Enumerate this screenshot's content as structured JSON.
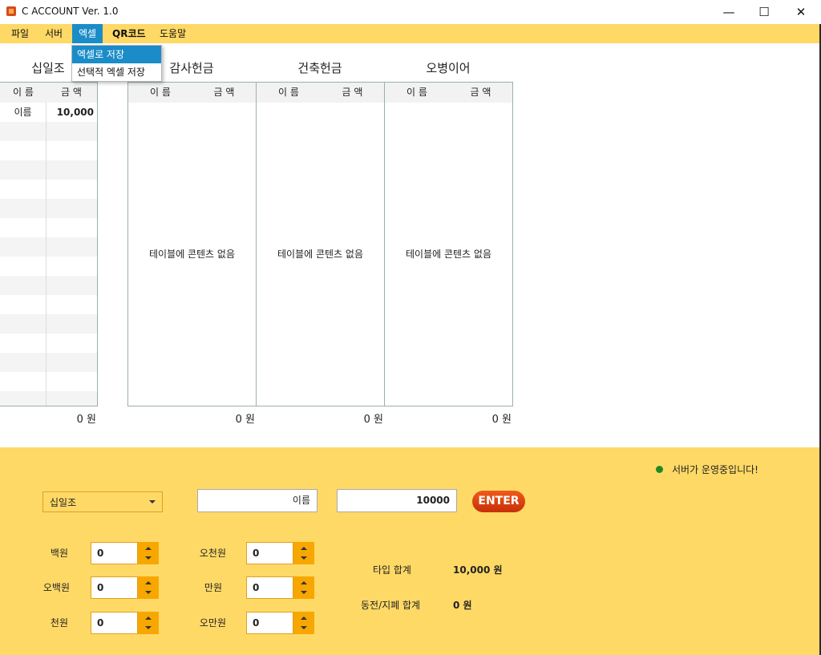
{
  "window": {
    "title": "C ACCOUNT Ver. 1.0",
    "min_glyph": "—",
    "max_glyph": "☐",
    "close_glyph": "✕"
  },
  "menu": {
    "items": [
      "파일",
      "서버",
      "엑셀",
      "QR코드",
      "도움말"
    ],
    "active": "엑셀",
    "dropdown": [
      "엑셀로 저장",
      "선택적 엑셀 저장"
    ],
    "dropdown_highlighted": "엑셀로 저장"
  },
  "columns": {
    "name": "이 름",
    "amount": "금 액"
  },
  "panels": [
    {
      "title": "십일조",
      "empty_message": "",
      "rows": [
        {
          "name": "이름",
          "amount": "10,000"
        }
      ],
      "total": "0 원"
    },
    {
      "title": "감사헌금",
      "empty_message": "테이블에 콘텐츠 없음",
      "rows": [],
      "total": "0 원"
    },
    {
      "title": "건축헌금",
      "empty_message": "테이블에 콘텐츠 없음",
      "rows": [],
      "total": "0 원"
    },
    {
      "title": "오병이어",
      "empty_message": "테이블에 콘텐츠 없음",
      "rows": [],
      "total": "0 원"
    }
  ],
  "status": {
    "text": "서버가 운영중입니다!",
    "color": "#1f8a1f"
  },
  "form": {
    "category": "십일조",
    "name_value": "이름",
    "amount_value": "10000",
    "enter_label": "ENTER"
  },
  "denominations": [
    {
      "label": "백원",
      "value": "0"
    },
    {
      "label": "오백원",
      "value": "0"
    },
    {
      "label": "천원",
      "value": "0"
    },
    {
      "label": "오천원",
      "value": "0"
    },
    {
      "label": "만원",
      "value": "0"
    },
    {
      "label": "오만원",
      "value": "0"
    }
  ],
  "summary": {
    "typed_total_label": "타입 합계",
    "typed_total_value": "10,000 원",
    "cash_total_label": "동전/지폐 합계",
    "cash_total_value": "0 원"
  },
  "colors": {
    "accent_yellow": "#ffd966",
    "menu_highlight": "#1a8cc8",
    "spinner_orange": "#f7a700",
    "enter_red": "#d8400f"
  }
}
